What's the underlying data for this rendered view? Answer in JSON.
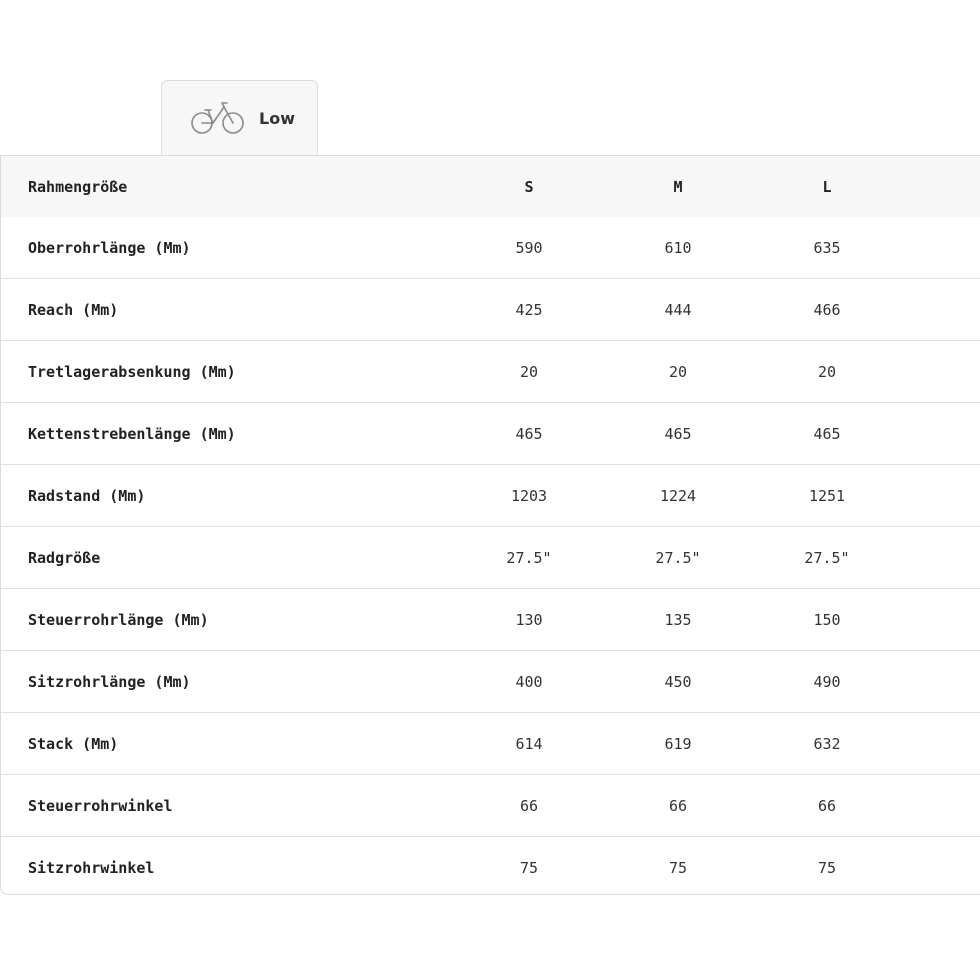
{
  "tab": {
    "label": "Low",
    "icon": "bicycle-icon"
  },
  "table": {
    "header": {
      "label": "Rahmengröße",
      "sizes": [
        "S",
        "M",
        "L"
      ]
    },
    "rows": [
      {
        "label": "Oberrohrlänge (Mm)",
        "values": [
          "590",
          "610",
          "635"
        ]
      },
      {
        "label": "Reach (Mm)",
        "values": [
          "425",
          "444",
          "466"
        ]
      },
      {
        "label": "Tretlagerabsenkung (Mm)",
        "values": [
          "20",
          "20",
          "20"
        ]
      },
      {
        "label": "Kettenstrebenlänge (Mm)",
        "values": [
          "465",
          "465",
          "465"
        ]
      },
      {
        "label": "Radstand (Mm)",
        "values": [
          "1203",
          "1224",
          "1251"
        ]
      },
      {
        "label": "Radgröße",
        "values": [
          "27.5\"",
          "27.5\"",
          "27.5\""
        ]
      },
      {
        "label": "Steuerrohrlänge (Mm)",
        "values": [
          "130",
          "135",
          "150"
        ]
      },
      {
        "label": "Sitzrohrlänge (Mm)",
        "values": [
          "400",
          "450",
          "490"
        ]
      },
      {
        "label": "Stack (Mm)",
        "values": [
          "614",
          "619",
          "632"
        ]
      },
      {
        "label": "Steuerrohrwinkel",
        "values": [
          "66",
          "66",
          "66"
        ]
      },
      {
        "label": "Sitzrohrwinkel",
        "values": [
          "75",
          "75",
          "75"
        ]
      }
    ]
  }
}
